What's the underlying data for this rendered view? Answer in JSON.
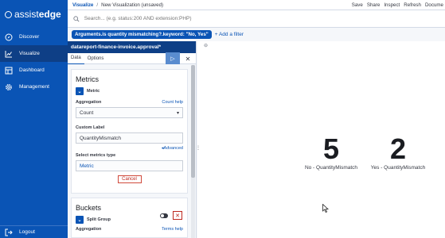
{
  "nav": {
    "brand_light": "assist",
    "brand_bold": "edge",
    "items": [
      {
        "label": "Discover",
        "icon": "compass-icon"
      },
      {
        "label": "Visualize",
        "icon": "chart-icon"
      },
      {
        "label": "Dashboard",
        "icon": "dashboard-icon"
      },
      {
        "label": "Management",
        "icon": "gear-icon"
      }
    ],
    "logout": "Logout"
  },
  "topbar": {
    "crumb_root": "Visualize",
    "crumb_separator": "/",
    "crumb_current": "New Visualization (unsaved)",
    "actions": [
      "Save",
      "Share",
      "Inspect",
      "Refresh",
      "Docume"
    ]
  },
  "search": {
    "placeholder": "Search... (e.g. status:200 AND extension:PHP)"
  },
  "filters": {
    "pill": "Arguments.is quantity mismatching?.keyword: \"No, Yes\"",
    "add_label": "+ Add a filter"
  },
  "editor": {
    "index_title": "datareport-finance-invoice.approval*",
    "tabs": [
      "Data",
      "Options"
    ],
    "metrics": {
      "heading": "Metrics",
      "metric_label": "Metric",
      "aggregation_label": "Aggregation",
      "count_help": "Count help",
      "aggregation_value": "Count",
      "custom_label_label": "Custom Label",
      "custom_label_value": "QuantityMismatch",
      "advanced": "Advanced",
      "select_type_label": "Select metrics type",
      "select_type_value": "Metric",
      "cancel": "Cancel"
    },
    "buckets": {
      "heading": "Buckets",
      "split_label": "Split Group",
      "aggregation_label": "Aggregation",
      "terms_help": "Terms help"
    }
  },
  "visualization": {
    "metrics": [
      {
        "value": "5",
        "label": "No - QuantityMismatch"
      },
      {
        "value": "2",
        "label": "Yes - QuantityMismatch"
      }
    ]
  },
  "colors": {
    "nav_bg": "#0a54b5",
    "nav_active": "#0e3f86",
    "accent": "#0a54b5",
    "danger": "#bd271e"
  }
}
